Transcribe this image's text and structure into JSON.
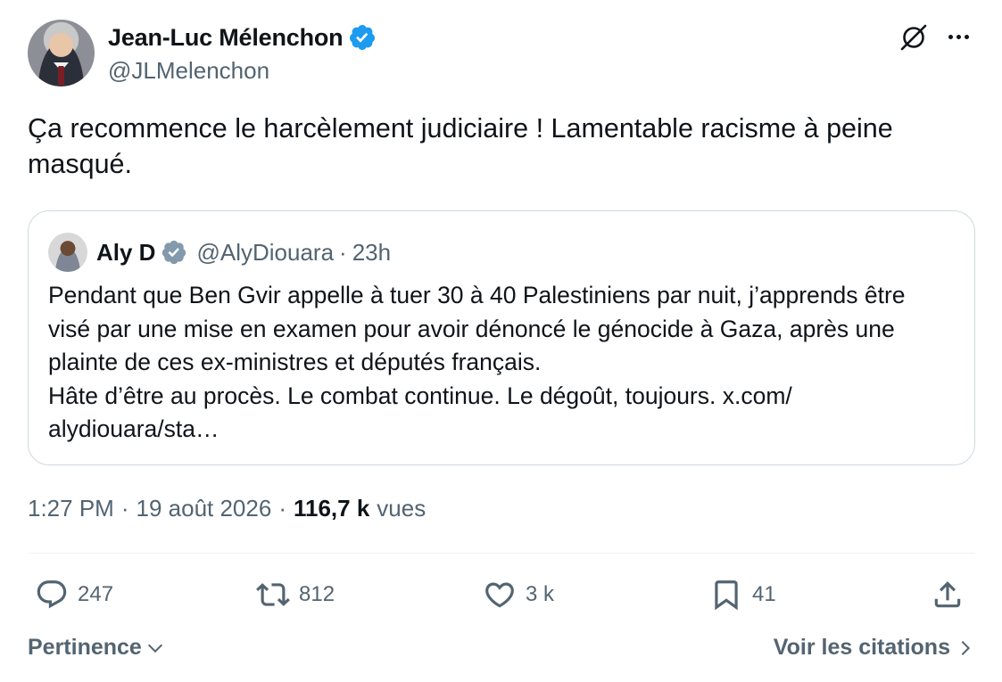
{
  "author": {
    "name": "Jean-Luc Mélenchon",
    "handle": "@JLMelenchon",
    "verified": true
  },
  "tweet": {
    "text": "Ça recommence le harcèlement judiciaire ! Lamentable racisme à peine masqué."
  },
  "quoted": {
    "name": "Aly D",
    "handle": "@AlyDiouara",
    "separator": "·",
    "time": "23h",
    "text": "Pendant que Ben Gvir appelle à tuer 30 à 40 Palestiniens par nuit, j’apprends être visé par une mise en examen pour avoir dénoncé le génocide à Gaza, après une plainte de ces ex-ministres et députés français.\nHâte d’être au procès. Le combat continue. Le dégoût, toujours. x.com/\nalydiouara/sta…"
  },
  "meta": {
    "time": "1:27 PM",
    "sep": "·",
    "date": "19 août 2026",
    "views_count": "116,7 k",
    "views_label": "vues"
  },
  "actions": {
    "replies": "247",
    "reposts": "812",
    "likes": "3 k",
    "bookmarks": "41"
  },
  "footer": {
    "sort_label": "Pertinence",
    "quotes_label": "Voir les citations"
  },
  "colors": {
    "verified": "#1d9bf0",
    "text": "#0f1419",
    "secondary": "#536471",
    "border": "#cfd9de"
  },
  "icons": [
    "verified-badge-icon",
    "grok-icon",
    "more-icon",
    "reply-icon",
    "repost-icon",
    "like-icon",
    "bookmark-icon",
    "share-icon",
    "chevron-down-icon",
    "chevron-right-icon"
  ]
}
